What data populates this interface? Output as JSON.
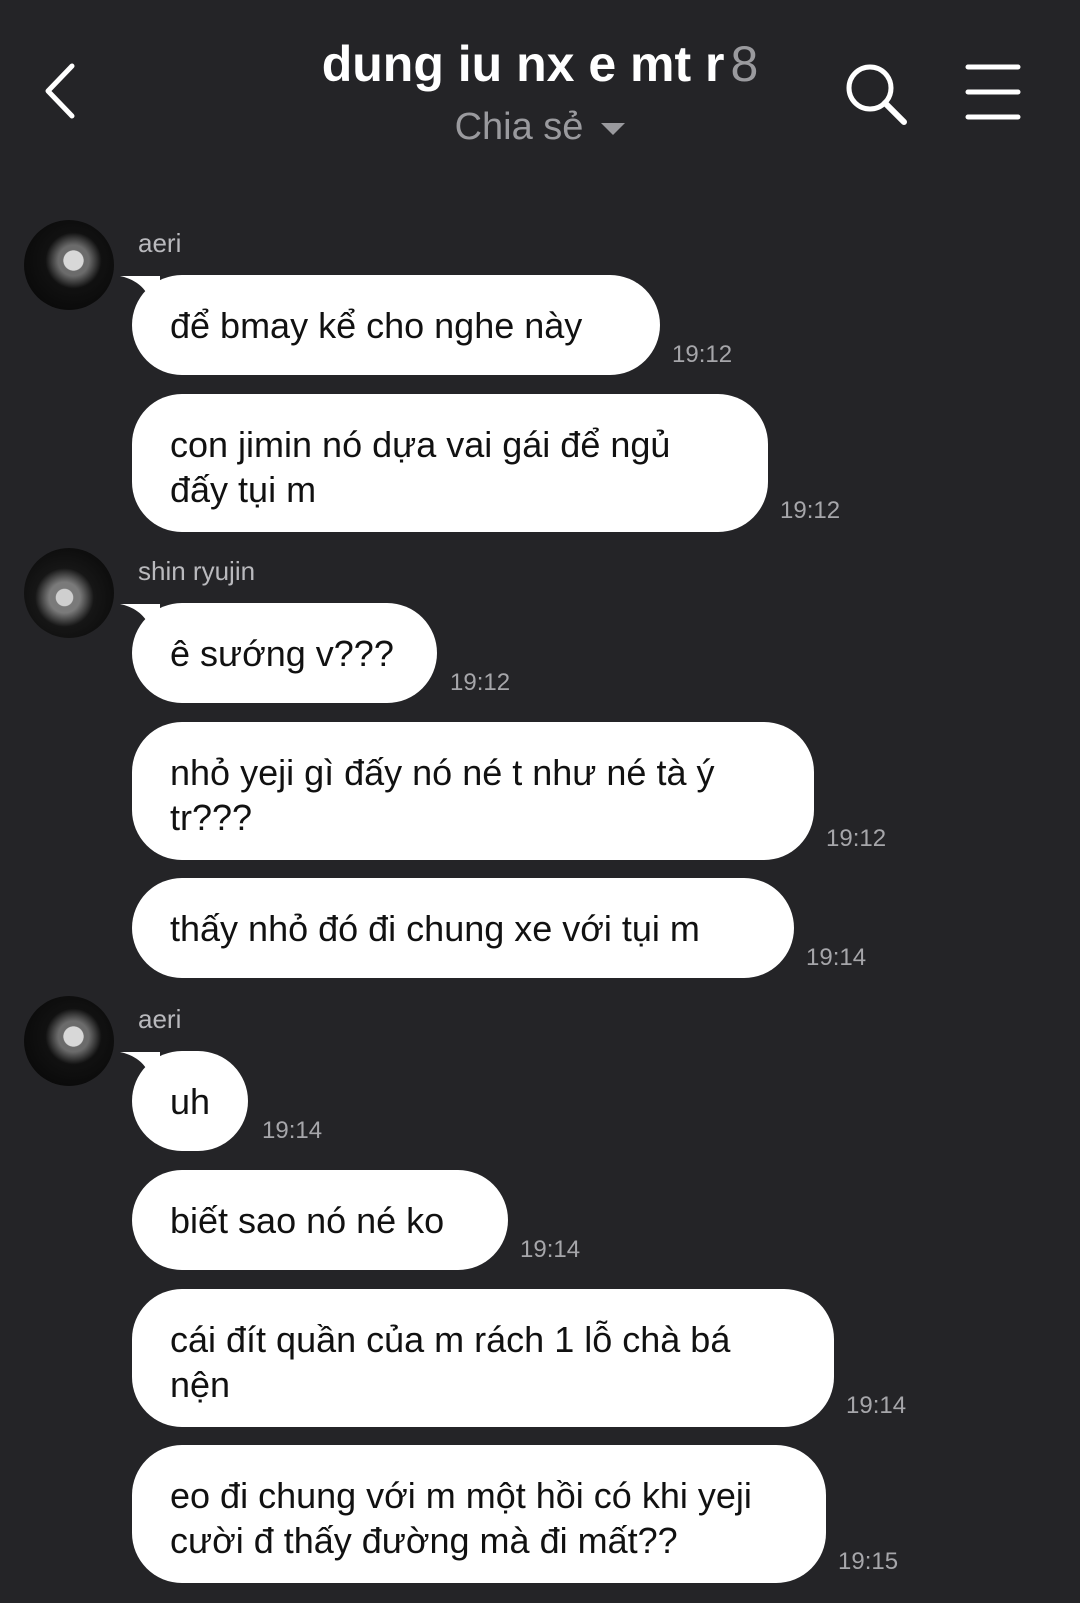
{
  "header": {
    "title": "dung iu nx e mt r",
    "member_count": "8",
    "subtitle": "Chia sẻ",
    "icons": {
      "back": "chevron-left-icon",
      "search": "search-icon",
      "menu": "hamburger-menu-icon",
      "dropdown": "caret-down-icon"
    }
  },
  "colors": {
    "background": "#242427",
    "bubble": "#ffffff",
    "bubble_text": "#111111",
    "title": "#ffffff",
    "muted": "#9a9a9e"
  },
  "groups": [
    {
      "sender": "aeri",
      "messages": [
        {
          "text": "để bmay kể cho nghe này",
          "time": "19:12"
        },
        {
          "text": "con jimin nó dựa vai gái để ngủ đấy tụi m",
          "time": "19:12"
        }
      ]
    },
    {
      "sender": "shin ryujin",
      "messages": [
        {
          "text": "ê sướng v???",
          "time": "19:12"
        },
        {
          "text": "nhỏ yeji gì đấy nó né t như né tà ý tr???",
          "time": "19:12"
        },
        {
          "text": "thấy nhỏ đó đi chung xe với tụi m",
          "time": "19:14"
        }
      ]
    },
    {
      "sender": "aeri",
      "messages": [
        {
          "text": "uh",
          "time": "19:14"
        },
        {
          "text": "biết sao nó né ko",
          "time": "19:14"
        },
        {
          "text": "cái đít quần của m rách 1 lỗ chà bá nện",
          "time": "19:14"
        },
        {
          "text": "eo đi chung với m một hồi có khi yeji cười đ thấy đường mà đi mất??",
          "time": "19:15"
        }
      ]
    }
  ]
}
